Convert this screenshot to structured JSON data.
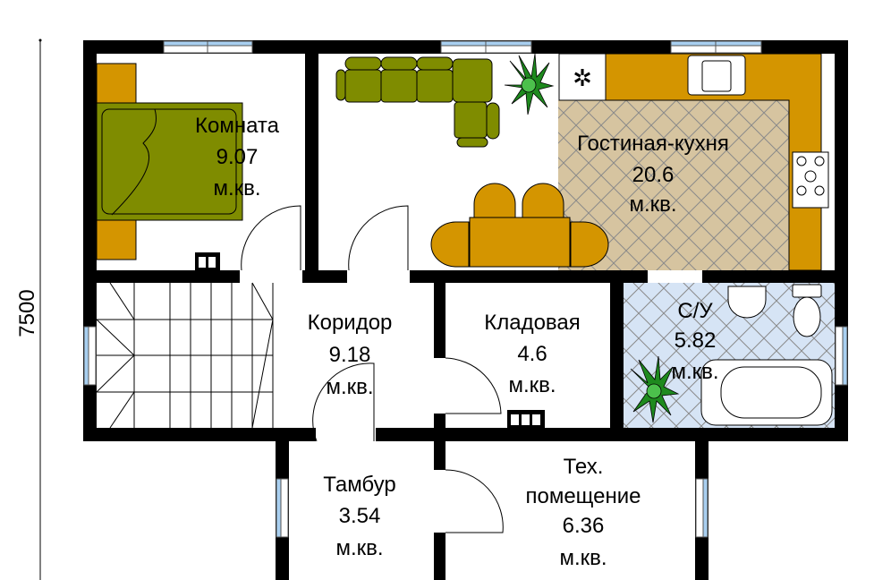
{
  "dimension_label": "7500",
  "unit": "м.кв.",
  "colors": {
    "wall": "#000000",
    "furniture_green": "#7f8c00",
    "furniture_orange": "#d49500",
    "kitchen_floor": "#d6c4a0",
    "bath_floor": "#d6e4f5",
    "window": "#a8cff0"
  },
  "rooms": [
    {
      "name": "Комната",
      "area": "9.07",
      "unit": "м.кв."
    },
    {
      "name": "Гостиная-кухня",
      "area": "20.6",
      "unit": "м.кв."
    },
    {
      "name": "Коридор",
      "area": "9.18",
      "unit": "м.кв."
    },
    {
      "name": "Кладовая",
      "area": "4.6",
      "unit": "м.кв."
    },
    {
      "name": "С/У",
      "area": "5.82",
      "unit": "м.кв."
    },
    {
      "name": "Тамбур",
      "area": "3.54",
      "unit": "м.кв."
    },
    {
      "name": "Тех. помещение",
      "name_line1": "Тех.",
      "name_line2": "помещение",
      "area": "6.36",
      "unit": "м.кв."
    }
  ]
}
